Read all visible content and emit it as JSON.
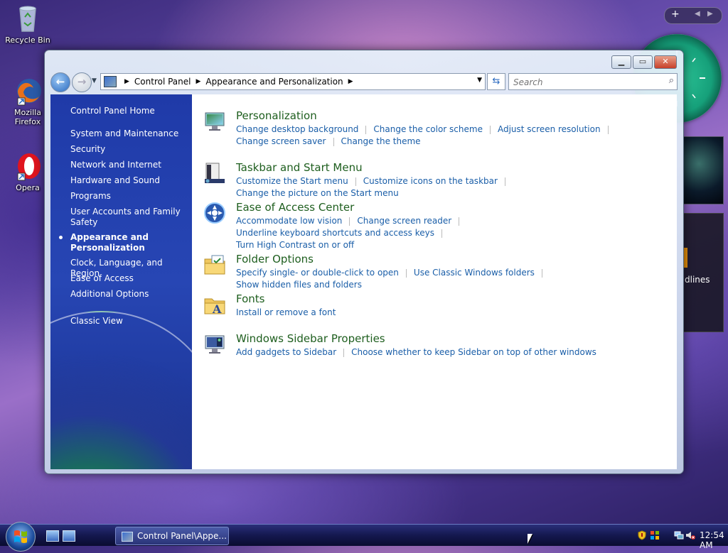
{
  "desktop": {
    "icons": [
      {
        "label": "Recycle Bin",
        "icon": "recycle-bin-icon"
      },
      {
        "label": "Mozilla Firefox",
        "icon": "firefox-icon"
      },
      {
        "label": "Opera",
        "icon": "opera-icon"
      }
    ],
    "feed_gadget_text": "dlines"
  },
  "window": {
    "address": {
      "crumbs": [
        "Control Panel",
        "Appearance and Personalization"
      ],
      "search_placeholder": "Search"
    },
    "sidebar": {
      "home": "Control Panel Home",
      "items": [
        "System and Maintenance",
        "Security",
        "Network and Internet",
        "Hardware and Sound",
        "Programs",
        "User Accounts and Family Safety",
        "Appearance and Personalization",
        "Clock, Language, and Region",
        "Ease of Access",
        "Additional Options"
      ],
      "selected": "Appearance and Personalization",
      "classic_view": "Classic View"
    },
    "categories": [
      {
        "title": "Personalization",
        "icon": "personalization-icon",
        "links": [
          "Change desktop background",
          "Change the color scheme",
          "Adjust screen resolution",
          "Change screen saver",
          "Change the theme"
        ]
      },
      {
        "title": "Taskbar and Start Menu",
        "icon": "taskbar-icon",
        "links": [
          "Customize the Start menu",
          "Customize icons on the taskbar",
          "Change the picture on the Start menu"
        ]
      },
      {
        "title": "Ease of Access Center",
        "icon": "ease-of-access-icon",
        "links": [
          "Accommodate low vision",
          "Change screen reader",
          "Underline keyboard shortcuts and access keys",
          "Turn High Contrast on or off"
        ]
      },
      {
        "title": "Folder Options",
        "icon": "folder-options-icon",
        "links": [
          "Specify single- or double-click to open",
          "Use Classic Windows folders",
          "Show hidden files and folders"
        ]
      },
      {
        "title": "Fonts",
        "icon": "fonts-icon",
        "links": [
          "Install or remove a font"
        ]
      },
      {
        "title": "Windows Sidebar Properties",
        "icon": "sidebar-properties-icon",
        "links": [
          "Add gadgets to Sidebar",
          "Choose whether to keep Sidebar on top of other windows"
        ]
      }
    ]
  },
  "taskbar": {
    "task_button": "Control Panel\\Appe...",
    "clock": "12:54 AM"
  },
  "colors": {
    "link": "#1a5ea8",
    "category_title": "#1e5e1e",
    "sidebar": "#2746b4"
  }
}
